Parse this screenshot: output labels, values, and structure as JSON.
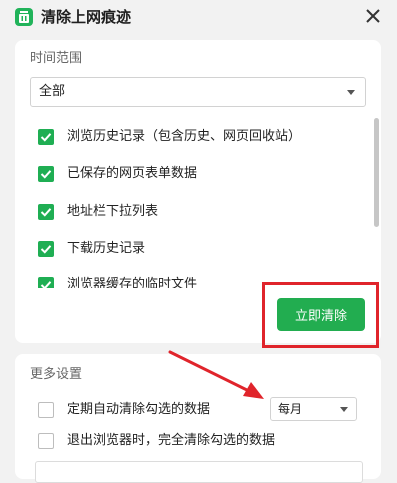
{
  "window": {
    "title": "清除上网痕迹",
    "icon": "trash-icon",
    "accent_color": "#21b35a"
  },
  "time_range": {
    "heading": "时间范围",
    "selected": "全部"
  },
  "items": [
    {
      "label": "浏览历史记录（包含历史、网页回收站）",
      "checked": true
    },
    {
      "label": "已保存的网页表单数据",
      "checked": true
    },
    {
      "label": "地址栏下拉列表",
      "checked": true
    },
    {
      "label": "下载历史记录",
      "checked": true
    },
    {
      "label": "浏览器缓存的临时文件",
      "checked": true
    }
  ],
  "clear_button": {
    "label": "立即清除",
    "color": "#22ad50"
  },
  "annotation": {
    "highlight_color": "#e0242b"
  },
  "more_settings": {
    "heading": "更多设置",
    "periodic_clear": {
      "label": "定期自动清除勾选的数据",
      "checked": false
    },
    "frequency": {
      "selected": "每月"
    },
    "clear_on_exit": {
      "label": "退出浏览器时，完全清除勾选的数据",
      "checked": false
    }
  }
}
